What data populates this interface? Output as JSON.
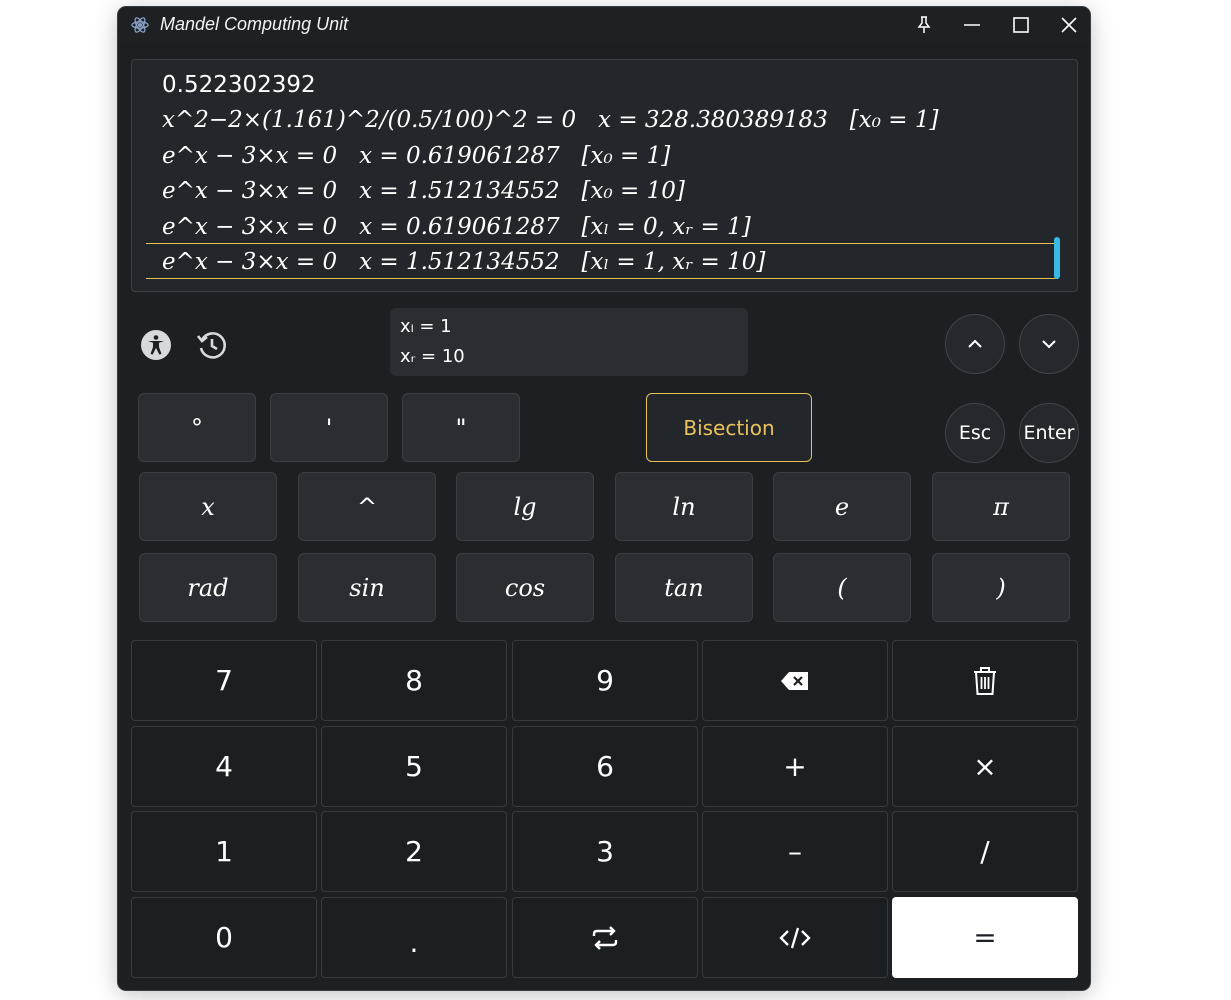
{
  "window": {
    "title": "Mandel Computing Unit",
    "accent_color": "#e6c15a",
    "scrollbar_color": "#3ab8e6"
  },
  "history": [
    {
      "expr": "0.522302392",
      "result": "",
      "params": ""
    },
    {
      "expr": "x^2−2×(1.161)^2/(0.5/100)^2 = 0",
      "result": "x = 328.380389183",
      "params": "[x₀ = 1]"
    },
    {
      "expr": "e^x − 3×x = 0",
      "result": "x = 0.619061287",
      "params": "[x₀ = 1]"
    },
    {
      "expr": "e^x − 3×x = 0",
      "result": "x = 1.512134552",
      "params": "[x₀ = 10]"
    },
    {
      "expr": "e^x − 3×x = 0",
      "result": "x = 0.619061287",
      "params": "[xₗ = 0, xᵣ = 1]"
    },
    {
      "expr": "e^x − 3×x = 0",
      "result": "x = 1.512134552",
      "params": "[xₗ = 1, xᵣ = 10]"
    }
  ],
  "toolbar": {
    "accessibility_icon": "accessibility-icon",
    "history_icon": "history-icon",
    "up_icon": "chevron-up-icon",
    "down_icon": "chevron-down-icon",
    "esc_label": "Esc",
    "enter_label": "Enter"
  },
  "params_panel": {
    "line1": "xₗ = 1",
    "line2": "xᵣ = 10"
  },
  "angle_keys": [
    "°",
    "'",
    "\""
  ],
  "method_label": "Bisection",
  "function_keys": {
    "row1": [
      "x",
      "^",
      "lg",
      "ln",
      "e",
      "π"
    ],
    "row2": [
      "rad",
      "sin",
      "cos",
      "tan",
      "(",
      ")"
    ]
  },
  "numpad": {
    "row1": [
      "7",
      "8",
      "9",
      "backspace-icon",
      "trash-icon"
    ],
    "row2": [
      "4",
      "5",
      "6",
      "+",
      "×"
    ],
    "row3": [
      "1",
      "2",
      "3",
      "–",
      "/"
    ],
    "row4": [
      "0",
      ".",
      "swap-icon",
      "code-icon",
      "="
    ]
  }
}
